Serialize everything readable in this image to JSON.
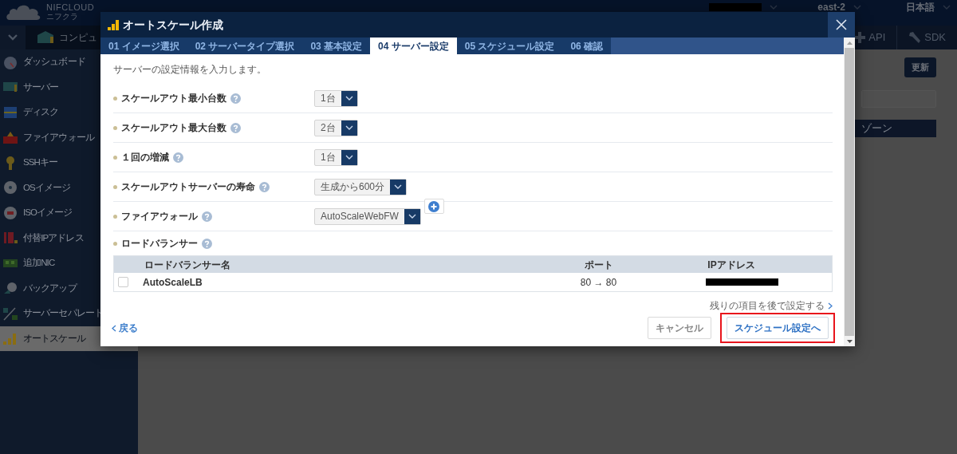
{
  "header": {
    "logo": "NIFCLOUD",
    "logo_sub": "ニフクラ",
    "region": "east-2",
    "language": "日本語"
  },
  "toolbar": {
    "service": "コンピュ",
    "links": [
      {
        "label": "API",
        "kind": "plus"
      },
      {
        "label": "SDK",
        "kind": "wrench"
      }
    ]
  },
  "sidebar": {
    "items": [
      {
        "label": "ダッシュボード",
        "kind": "gauge",
        "selected": false
      },
      {
        "label": "サーバー",
        "kind": "server",
        "selected": false
      },
      {
        "label": "ディスク",
        "kind": "disk",
        "selected": false
      },
      {
        "label": "ファイアウォール",
        "kind": "firewall",
        "selected": false
      },
      {
        "label": "SSHキー",
        "kind": "key",
        "selected": false
      },
      {
        "label": "OSイメージ",
        "kind": "disc",
        "selected": false
      },
      {
        "label": "ISOイメージ",
        "kind": "iso",
        "selected": false
      },
      {
        "label": "付替IPアドレス",
        "kind": "ip",
        "selected": false
      },
      {
        "label": "追加NIC",
        "kind": "nic",
        "selected": false
      },
      {
        "label": "バックアップ",
        "kind": "backup",
        "selected": false
      },
      {
        "label": "サーバーセパレート",
        "kind": "separate",
        "selected": false
      },
      {
        "label": "オートスケール",
        "kind": "autoscale",
        "selected": true
      }
    ]
  },
  "main": {
    "refresh_button": "更新",
    "table_columns": [
      "ゾーン"
    ]
  },
  "modal": {
    "title": "オートスケール作成",
    "tabs": [
      {
        "label": "01 イメージ選択",
        "selected": false
      },
      {
        "label": "02 サーバータイプ選択",
        "selected": false
      },
      {
        "label": "03 基本設定",
        "selected": false
      },
      {
        "label": "04 サーバー設定",
        "selected": true
      },
      {
        "label": "05 スケジュール設定",
        "selected": false
      },
      {
        "label": "06 確認",
        "selected": false
      }
    ],
    "intro": "サーバーの設定情報を入力します。",
    "fields": [
      {
        "label": "スケールアウト最小台数",
        "kind": "select",
        "value": "1台"
      },
      {
        "label": "スケールアウト最大台数",
        "kind": "select",
        "value": "2台"
      },
      {
        "label": "１回の増減",
        "kind": "select",
        "value": "1台"
      },
      {
        "label": "スケールアウトサーバーの寿命",
        "kind": "select",
        "value": "生成から600分"
      },
      {
        "label": "ファイアウォール",
        "kind": "select_add",
        "value": "AutoScaleWebFW"
      },
      {
        "label": "ロードバランサー",
        "kind": "table"
      }
    ],
    "lb_table": {
      "columns": [
        "ロードバランサー名",
        "ポート",
        "IPアドレス"
      ],
      "rows": [
        {
          "name": "AutoScaleLB",
          "port": "80 → 80",
          "checked": false
        }
      ]
    },
    "later_link": "残りの項目を後で設定する",
    "back_link": "戻る",
    "buttons": [
      {
        "label": "キャンセル",
        "kind": "secondary",
        "highlighted": false
      },
      {
        "label": "スケジュール設定へ",
        "kind": "primary",
        "highlighted": true
      }
    ]
  }
}
